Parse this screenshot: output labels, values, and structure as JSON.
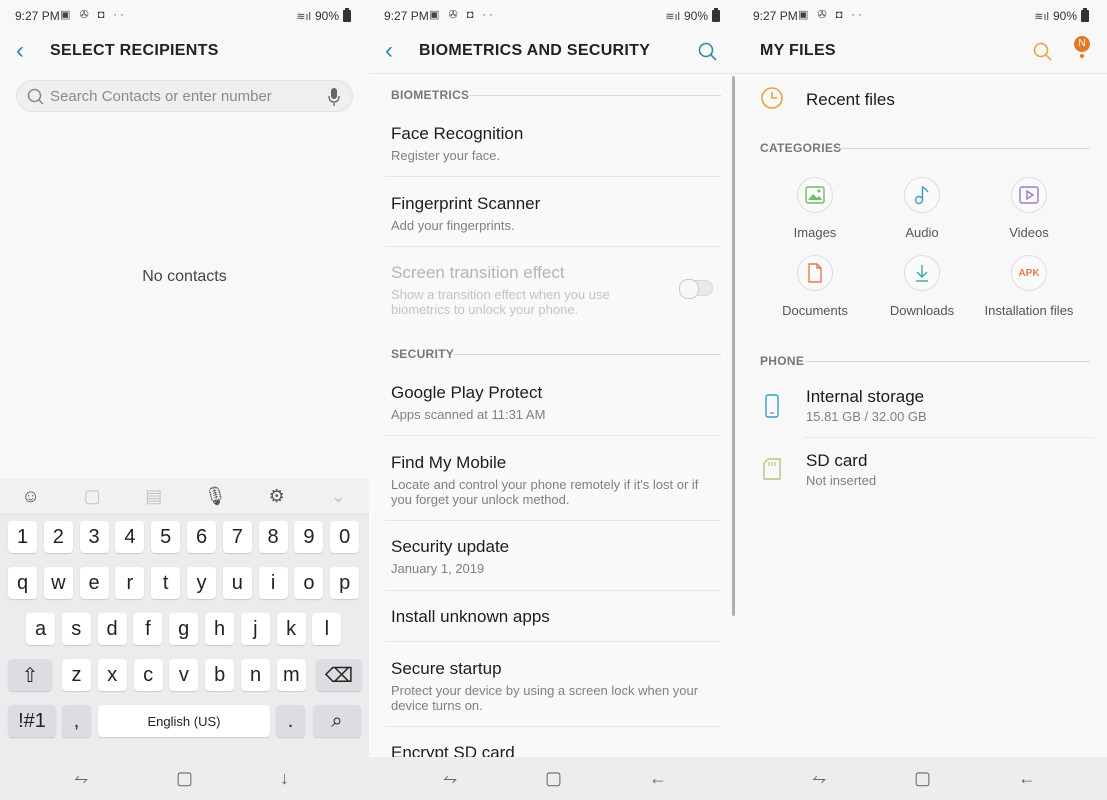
{
  "status": {
    "time": "9:27 PM",
    "battery": "90%"
  },
  "panel1": {
    "title": "SELECT RECIPIENTS",
    "search_placeholder": "Search Contacts or enter number",
    "empty_text": "No contacts",
    "keyboard": {
      "toolbar_icons": [
        "emoji-icon",
        "sticker-icon",
        "clipboard-icon",
        "mic-icon",
        "settings-icon",
        "chevron-down-icon"
      ],
      "row_numbers": [
        "1",
        "2",
        "3",
        "4",
        "5",
        "6",
        "7",
        "8",
        "9",
        "0"
      ],
      "row_top": [
        "q",
        "w",
        "e",
        "r",
        "t",
        "y",
        "u",
        "i",
        "o",
        "p"
      ],
      "row_mid": [
        "a",
        "s",
        "d",
        "f",
        "g",
        "h",
        "j",
        "k",
        "l"
      ],
      "row_bottom": [
        "z",
        "x",
        "c",
        "v",
        "b",
        "n",
        "m"
      ],
      "symbols_key": "!#1",
      "comma_key": ",",
      "space_label": "English (US)",
      "period_key": "."
    }
  },
  "panel2": {
    "title": "BIOMETRICS AND SECURITY",
    "section_biometrics": "BIOMETRICS",
    "section_security": "SECURITY",
    "items": [
      {
        "title": "Face Recognition",
        "subtitle": "Register your face."
      },
      {
        "title": "Fingerprint Scanner",
        "subtitle": "Add your fingerprints."
      },
      {
        "title": "Screen transition effect",
        "subtitle": "Show a transition effect when you use biometrics to unlock your phone.",
        "enabled": false,
        "toggle": false
      },
      {
        "title": "Google Play Protect",
        "subtitle": "Apps scanned at 11:31 AM"
      },
      {
        "title": "Find My Mobile",
        "subtitle": "Locate and control your phone remotely if it's lost or if you forget your unlock method."
      },
      {
        "title": "Security update",
        "subtitle": "January 1, 2019"
      },
      {
        "title": "Install unknown apps",
        "subtitle": ""
      },
      {
        "title": "Secure startup",
        "subtitle": "Protect your device by using a screen lock when your device turns on."
      },
      {
        "title": "Encrypt SD card",
        "subtitle": ""
      }
    ]
  },
  "panel3": {
    "title": "MY FILES",
    "avatar_letter": "N",
    "recent": "Recent files",
    "section_categories": "CATEGORIES",
    "categories": [
      "Images",
      "Audio",
      "Videos",
      "Documents",
      "Downloads",
      "Installation files"
    ],
    "apk_label": "APK",
    "section_phone": "PHONE",
    "storage": [
      {
        "title": "Internal storage",
        "subtitle": "15.81 GB / 32.00 GB"
      },
      {
        "title": "SD card",
        "subtitle": "Not inserted"
      }
    ],
    "accent": "#e8a33d"
  },
  "colors": {
    "teal_accent": "#2b8fa3",
    "orange_accent": "#e8a33d"
  }
}
